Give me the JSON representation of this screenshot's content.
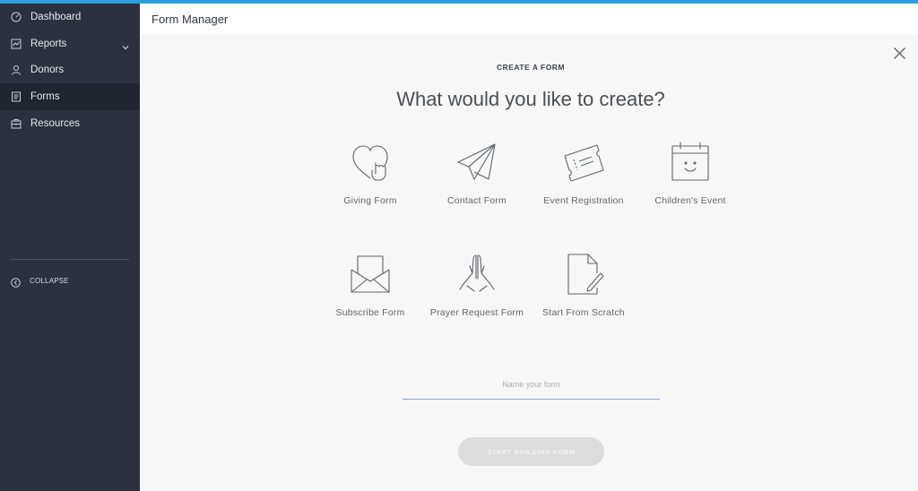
{
  "app": {
    "accent_color": "#2aa1dc",
    "sidebar_bg": "#2b323e",
    "active_bg": "#202630"
  },
  "sidebar": {
    "items": [
      {
        "label": "Dashboard",
        "icon": "dashboard-icon"
      },
      {
        "label": "Reports",
        "icon": "reports-icon",
        "has_submenu": true
      },
      {
        "label": "Donors",
        "icon": "donors-icon"
      },
      {
        "label": "Forms",
        "icon": "forms-icon",
        "active": true
      },
      {
        "label": "Resources",
        "icon": "resources-icon"
      }
    ],
    "collapse_label": "COLLAPSE"
  },
  "header": {
    "title": "Form Manager"
  },
  "main": {
    "kicker": "CREATE A FORM",
    "headline": "What would you like to create?",
    "form_types": [
      {
        "label": "Giving Form",
        "icon": "heart-hand-icon"
      },
      {
        "label": "Contact Form",
        "icon": "paper-plane-icon"
      },
      {
        "label": "Event Registration",
        "icon": "ticket-icon"
      },
      {
        "label": "Children's Event",
        "icon": "calendar-smile-icon"
      },
      {
        "label": "Subscribe Form",
        "icon": "envelope-icon"
      },
      {
        "label": "Prayer Request Form",
        "icon": "praying-hands-icon"
      },
      {
        "label": "Start From Scratch",
        "icon": "document-pencil-icon"
      }
    ],
    "name_placeholder": "Name your form",
    "name_value": "",
    "submit_label": "START BUILDING FORM"
  }
}
